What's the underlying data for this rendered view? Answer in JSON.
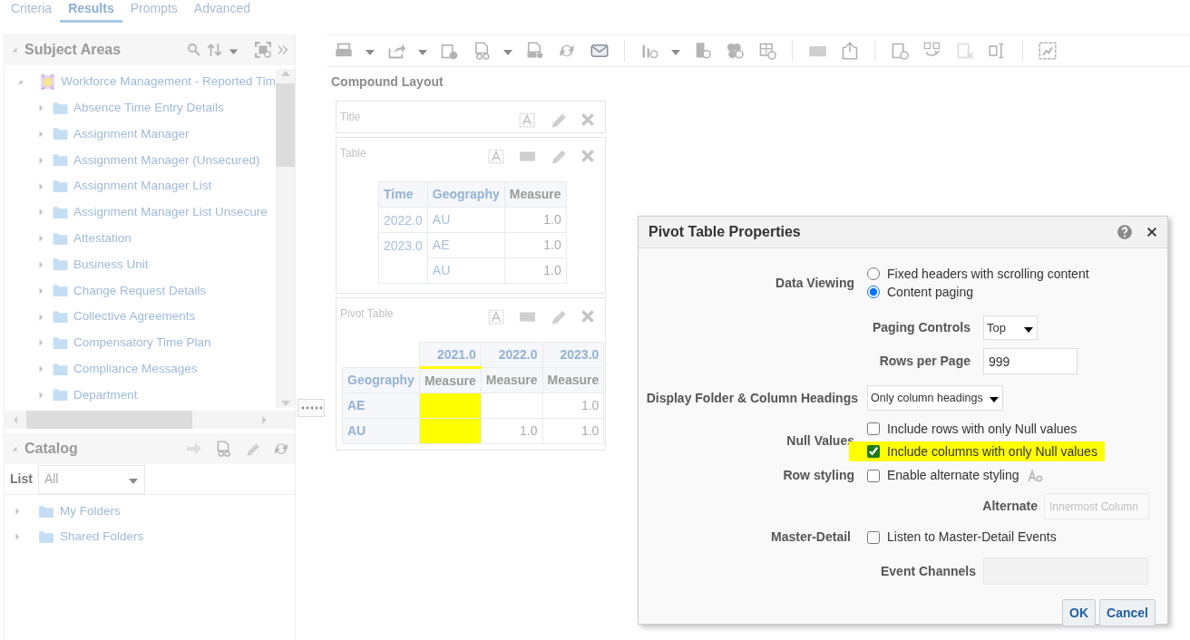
{
  "tabs": [
    {
      "label": "Criteria",
      "selected": false
    },
    {
      "label": "Results",
      "selected": true
    },
    {
      "label": "Prompts",
      "selected": false
    },
    {
      "label": "Advanced",
      "selected": false
    }
  ],
  "subject_areas": {
    "title": "Subject Areas",
    "root": {
      "label": "Workforce Management - Reported Tim",
      "expanded": true,
      "children": [
        {
          "label": "Absence Time Entry Details",
          "expanded": false
        },
        {
          "label": "Assignment Manager",
          "expanded": false
        },
        {
          "label": "Assignment Manager (Unsecured)",
          "expanded": false
        },
        {
          "label": "Assignment Manager List",
          "expanded": false
        },
        {
          "label": "Assignment Manager List Unsecure",
          "expanded": false
        },
        {
          "label": "Attestation",
          "expanded": false
        },
        {
          "label": "Business Unit",
          "expanded": false
        },
        {
          "label": "Change Request Details",
          "expanded": false
        },
        {
          "label": "Collective Agreements",
          "expanded": false
        },
        {
          "label": "Compensatory Time Plan",
          "expanded": false
        },
        {
          "label": "Compliance Messages",
          "expanded": false
        },
        {
          "label": "Department",
          "expanded": false
        }
      ]
    }
  },
  "catalog": {
    "title": "Catalog",
    "list_label": "List",
    "list_value": "All",
    "folders": [
      {
        "label": "My Folders",
        "expanded": false
      },
      {
        "label": "Shared Folders",
        "expanded": false
      }
    ]
  },
  "compound_layout": {
    "title": "Compound Layout",
    "views": [
      {
        "kind": "title",
        "label": "Title"
      },
      {
        "kind": "table",
        "label": "Table",
        "columns": [
          "Time",
          "Geography",
          "Measure"
        ],
        "rows": [
          {
            "time": "2022.0",
            "geography": "AU",
            "measure": "1.0"
          },
          {
            "time": "2023.0",
            "geography": "AE",
            "measure": "1.0"
          },
          {
            "geography": "AU",
            "measure": "1.0"
          }
        ]
      },
      {
        "kind": "pivot",
        "label": "Pivot Table",
        "row_header": "Geography",
        "columns": [
          {
            "year": "2021.0",
            "measure": "Measure",
            "highlighted": true
          },
          {
            "year": "2022.0",
            "measure": "Measure",
            "highlighted": false
          },
          {
            "year": "2023.0",
            "measure": "Measure",
            "highlighted": false
          }
        ],
        "rows": [
          {
            "label": "AE",
            "values": [
              {
                "kind": "blank"
              },
              {
                "kind": "blank"
              },
              {
                "kind": "value",
                "value": "1.0"
              }
            ]
          },
          {
            "label": "AU",
            "values": [
              {
                "kind": "blank"
              },
              {
                "kind": "value",
                "value": "1.0"
              },
              {
                "kind": "value",
                "value": "1.0"
              }
            ]
          }
        ]
      }
    ]
  },
  "dialog": {
    "title": "Pivot Table Properties",
    "data_viewing": {
      "label": "Data Viewing",
      "options": [
        {
          "label": "Fixed headers with scrolling content",
          "selected": false
        },
        {
          "label": "Content paging",
          "selected": true
        }
      ]
    },
    "paging_controls": {
      "label": "Paging Controls",
      "value": "Top"
    },
    "rows_per_page": {
      "label": "Rows per Page",
      "value": "999"
    },
    "headings": {
      "label": "Display Folder & Column Headings",
      "value": "Only column headings"
    },
    "null_values": {
      "label": "Null Values",
      "options": [
        {
          "label": "Include rows with only Null values",
          "checked": false,
          "highlighted": false
        },
        {
          "label": "Include columns with only Null values",
          "checked": true,
          "highlighted": true
        }
      ]
    },
    "row_styling": {
      "label": "Row styling",
      "option": {
        "label": "Enable alternate styling",
        "checked": false
      }
    },
    "alternate": {
      "label": "Alternate",
      "value": "Innermost Column",
      "disabled": true
    },
    "master_detail": {
      "label": "Master-Detail",
      "option": {
        "label": "Listen to Master-Detail Events",
        "checked": false
      }
    },
    "event_channels": {
      "label": "Event Channels",
      "disabled": true
    },
    "buttons": [
      "OK",
      "Cancel"
    ]
  }
}
